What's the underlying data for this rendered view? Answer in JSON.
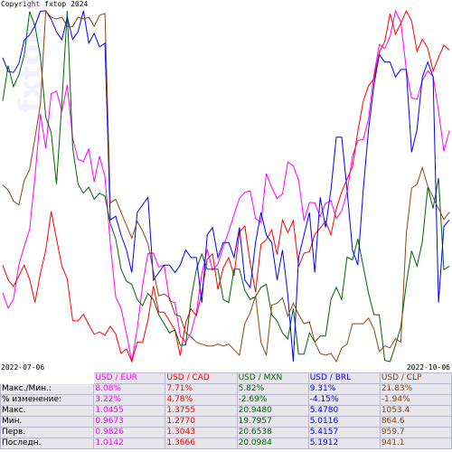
{
  "copyright": "Copyright fxtop 2024",
  "watermark": "fxtop.com",
  "chart_data": {
    "type": "line",
    "x_start": "2022-07-06",
    "x_end": "2022-10-06",
    "xlim": [
      "2022-07-06",
      "2022-10-06"
    ],
    "grid": false,
    "normalization": "each series plotted relative to its own min/max range",
    "series": [
      {
        "name": "USD / EUR",
        "color": "#ff00ff",
        "values": [
          0.9826,
          0.9792,
          0.9812,
          0.9889,
          0.993,
          0.9968,
          1.0085,
          1.0225,
          1.0148,
          1.027,
          1.0276,
          1.0231,
          1.029,
          1.0171,
          1.0124,
          1.0119,
          1.0147,
          1.0074,
          1.0131,
          1.0085,
          0.9936,
          0.9817,
          0.9792,
          0.9736,
          0.9673,
          0.9746,
          0.9843,
          0.9914,
          0.9915,
          0.9884,
          0.9888,
          0.9809,
          0.9804,
          0.973,
          0.9716,
          0.9737,
          0.9783,
          0.9868,
          0.9923,
          0.9877,
          0.9891,
          0.9929,
          0.9963,
          1.0001,
          1.0037,
          1.005,
          1.0054,
          0.9992,
          0.9983,
          1.0092,
          1.0061,
          1.0037,
          1.0047,
          1.0118,
          1.011,
          1.0078,
          0.9987,
          1.0028,
          1.0027,
          0.9996,
          1.0026,
          1.0032,
          0.9992,
          1.0009,
          1.0051,
          1.0131,
          1.0166,
          1.0168,
          1.0215,
          1.0313,
          1.038,
          1.0371,
          1.0398,
          1.0455,
          1.043,
          1.0325,
          1.0261,
          1.0258,
          1.03,
          1.0321,
          1.0309,
          1.0232,
          1.0142,
          1.0188
        ]
      },
      {
        "name": "USD / CAD",
        "color": "#ff0000",
        "values": [
          1.3043,
          1.3001,
          1.2983,
          1.3013,
          1.3043,
          1.3002,
          1.2938,
          1.302,
          1.3085,
          1.3195,
          1.3117,
          1.304,
          1.3004,
          1.2886,
          1.2885,
          1.2904,
          1.2875,
          1.2847,
          1.2854,
          1.2845,
          1.287,
          1.2848,
          1.2793,
          1.2806,
          1.277,
          1.2825,
          1.2824,
          1.2888,
          1.2984,
          1.291,
          1.291,
          1.2885,
          1.2859,
          1.2787,
          1.288,
          1.2919,
          1.29,
          1.2965,
          1.306,
          1.3075,
          1.2974,
          1.3036,
          1.3064,
          1.3013,
          1.3137,
          1.3154,
          1.3049,
          1.2967,
          1.3102,
          1.3115,
          1.3143,
          1.3073,
          1.3171,
          1.3135,
          1.3169,
          1.3039,
          1.3077,
          1.3081,
          1.313,
          1.3148,
          1.3167,
          1.3129,
          1.3203,
          1.325,
          1.3287,
          1.3322,
          1.3421,
          1.3507,
          1.3551,
          1.3571,
          1.3646,
          1.3676,
          1.3755,
          1.3697,
          1.3728,
          1.3763,
          1.3735,
          1.3648,
          1.3683,
          1.3657,
          1.3592,
          1.3631,
          1.3666,
          1.3652
        ]
      },
      {
        "name": "USD / MXN",
        "color": "#006400",
        "values": [
          20.6538,
          20.77,
          20.7,
          20.74,
          20.805,
          20.948,
          20.9,
          20.8,
          20.6,
          20.55,
          20.38,
          20.65,
          20.95,
          20.5,
          20.38,
          20.35,
          20.37,
          20.33,
          20.35,
          20.34,
          20.25,
          20.2,
          20.1,
          20.06,
          20.05,
          20.0,
          19.98,
          20.02,
          20.0,
          19.95,
          19.92,
          19.89,
          19.9,
          19.85,
          19.85,
          20.0,
          20.1,
          20.15,
          20.1,
          20.1,
          20.1,
          20.0,
          19.99,
          20.1,
          20.1,
          20.03,
          20.0,
          20.01,
          20.04,
          20.05,
          19.95,
          19.93,
          19.89,
          19.87,
          19.97,
          19.82,
          19.82,
          19.89,
          19.86,
          19.88,
          19.88,
          20.0,
          20.04,
          20.0,
          20.14,
          20.13,
          20.2,
          20.11,
          20.02,
          19.95,
          19.95,
          19.8,
          19.7957,
          19.85,
          19.91,
          20.05,
          20.16,
          20.11,
          20.19,
          20.37,
          20.3,
          20.4,
          20.0984,
          20.11
        ]
      },
      {
        "name": "USD / BRL",
        "color": "#0000ff",
        "values": [
          5.4157,
          5.3974,
          5.3961,
          5.4081,
          5.439,
          5.446,
          5.458,
          5.4775,
          5.478,
          5.467,
          5.45,
          5.4395,
          5.47,
          5.44,
          5.45,
          5.478,
          5.435,
          5.448,
          5.43,
          5.435,
          5.2,
          5.205,
          5.18,
          5.16,
          5.13,
          5.21,
          5.22,
          5.23,
          5.12,
          5.13,
          5.14,
          5.14,
          5.13,
          5.14,
          5.16,
          5.15,
          5.15,
          5.09,
          5.18,
          5.19,
          5.15,
          5.17,
          5.17,
          5.15,
          5.19,
          5.12,
          5.11,
          5.17,
          5.21,
          5.18,
          5.17,
          5.12,
          5.16,
          5.1,
          5.0116,
          5.15,
          5.18,
          5.21,
          5.13,
          5.23,
          5.19,
          5.24,
          5.31,
          5.31,
          5.24,
          5.16,
          5.14,
          5.24,
          5.32,
          5.38,
          5.42,
          5.41,
          5.41,
          5.39,
          5.4,
          5.4,
          5.29,
          5.32,
          5.39,
          5.41,
          5.39,
          5.09,
          5.1912,
          5.2
        ]
      },
      {
        "name": "USD / CLP",
        "color": "#8b4513",
        "values": [
          959.7,
          957.0,
          951.0,
          949.0,
          962.0,
          968.0,
          985.0,
          1003.0,
          1053.4,
          1050.0,
          1049.0,
          1050.0,
          1045.0,
          1045.0,
          1050.0,
          1049.0,
          1050.0,
          1045.0,
          1051.0,
          1052.0,
          950.0,
          952.0,
          945.0,
          938.0,
          931.0,
          940.0,
          935.0,
          928.0,
          913.0,
          900.0,
          901.0,
          899.0,
          890.0,
          889.0,
          880.0,
          878.0,
          875.0,
          874.0,
          873.0,
          873.0,
          874.0,
          873.0,
          874.0,
          871.0,
          868.0,
          885.0,
          891.0,
          900.0,
          875.0,
          868.0,
          895.0,
          896.0,
          899.0,
          889.0,
          896.0,
          890.0,
          885.0,
          886.0,
          875.0,
          869.0,
          868.0,
          869.0,
          864.6,
          872.0,
          874.0,
          885.0,
          885.0,
          885.0,
          888.0,
          882.0,
          870.0,
          873.0,
          872.0,
          877.0,
          875.0,
          933.0,
          958.0,
          960.0,
          969.0,
          959.0,
          953.0,
          947.0,
          941.1,
          945.0
        ]
      }
    ]
  },
  "table": {
    "headers": [
      "USD / EUR",
      "USD / CAD",
      "USD / MXN",
      "USD / BRL",
      "USD / CLP"
    ],
    "header_colors": [
      "#ff00ff",
      "#ff0000",
      "#006400",
      "#0000ff",
      "#8b4513"
    ],
    "rows": [
      {
        "label": "Макс./Мин.:",
        "values": [
          "8.08%",
          "7.71%",
          "5.82%",
          "9.31%",
          "21.83%"
        ]
      },
      {
        "label": "% изменение:",
        "values": [
          "3.22%",
          "4.78%",
          "-2.69%",
          "-4.15%",
          "-1.94%"
        ]
      },
      {
        "label": "Макс.",
        "values": [
          "1.0455",
          "1.3755",
          "20.9480",
          "5.4780",
          "1053.4"
        ]
      },
      {
        "label": "Мин.",
        "values": [
          "0.9673",
          "1.2770",
          "19.7957",
          "5.0116",
          "864.6"
        ]
      },
      {
        "label": "Перв.",
        "values": [
          "0.9826",
          "1.3043",
          "20.6538",
          "5.4157",
          "959.7"
        ]
      },
      {
        "label": "Последн.",
        "values": [
          "1.0142",
          "1.3666",
          "20.0984",
          "5.1912",
          "941.1"
        ]
      }
    ]
  }
}
